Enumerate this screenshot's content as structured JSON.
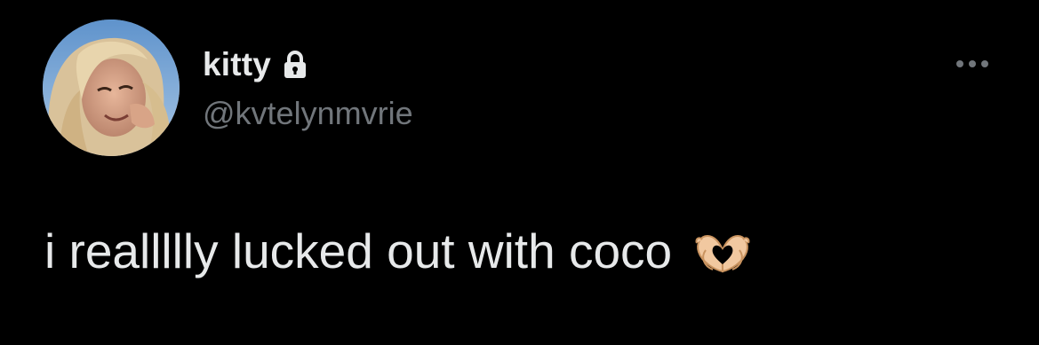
{
  "tweet": {
    "author": {
      "display_name": "kitty",
      "handle": "@kvtelynmvrie",
      "protected_icon": "lock-icon",
      "avatar": "profile-photo"
    },
    "menu_icon": "more-options-icon",
    "text": "i reallllly lucked out with coco",
    "emoji": "heart-hands-icon"
  },
  "colors": {
    "background": "#000000",
    "primary_text": "#e7e9ea",
    "secondary_text": "#71767b"
  }
}
